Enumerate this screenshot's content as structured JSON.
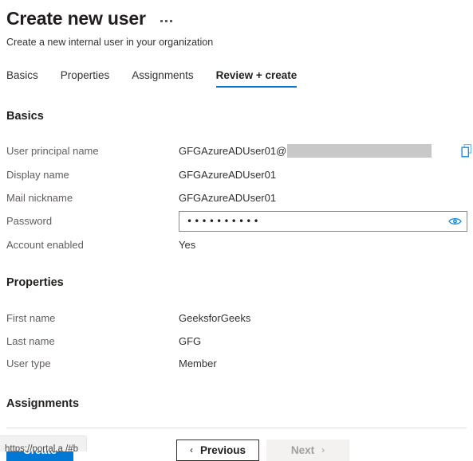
{
  "header": {
    "title": "Create new user",
    "subtitle": "Create a new internal user in your organization",
    "more_menu": "..."
  },
  "tabs": [
    {
      "label": "Basics",
      "active": false
    },
    {
      "label": "Properties",
      "active": false
    },
    {
      "label": "Assignments",
      "active": false
    },
    {
      "label": "Review + create",
      "active": true
    }
  ],
  "sections": {
    "basics": {
      "title": "Basics",
      "rows": [
        {
          "label": "User principal name",
          "value": "GFGAzureADUser01@",
          "redacted": true,
          "copy": true
        },
        {
          "label": "Display name",
          "value": "GFGAzureADUser01"
        },
        {
          "label": "Mail nickname",
          "value": "GFGAzureADUser01"
        },
        {
          "label": "Password",
          "value": "••••••••••",
          "is_password": true
        },
        {
          "label": "Account enabled",
          "value": "Yes"
        }
      ]
    },
    "properties": {
      "title": "Properties",
      "rows": [
        {
          "label": "First name",
          "value": "GeeksforGeeks"
        },
        {
          "label": "Last name",
          "value": "GFG"
        },
        {
          "label": "User type",
          "value": "Member"
        }
      ]
    },
    "assignments": {
      "title": "Assignments"
    }
  },
  "footer": {
    "create_label": "Create",
    "previous_label": "Previous",
    "next_label": "Next",
    "previous_chevron": "‹",
    "next_chevron": "›"
  },
  "status_bar": {
    "url": "https://portal.a               /#b"
  },
  "colors": {
    "accent": "#0078d4",
    "redaction": "#c8c8c8",
    "label_text": "#605e5c",
    "disabled_text": "#a19f9d"
  }
}
